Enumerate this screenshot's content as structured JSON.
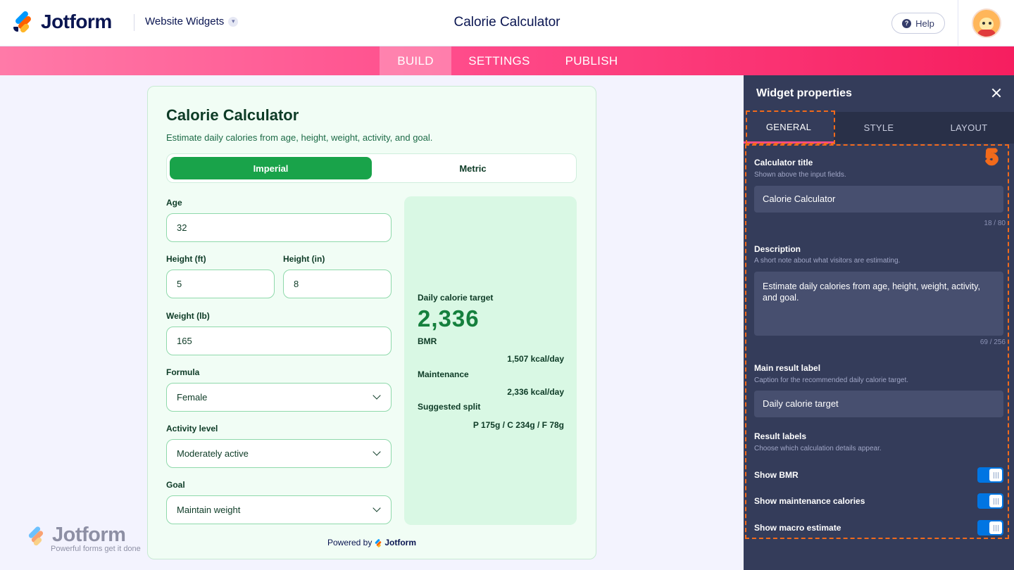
{
  "header": {
    "brand": "Jotform",
    "product_dropdown": "Website Widgets",
    "title": "Calorie Calculator",
    "help_label": "Help"
  },
  "nav": {
    "tabs": [
      {
        "label": "BUILD",
        "active": true
      },
      {
        "label": "SETTINGS",
        "active": false
      },
      {
        "label": "PUBLISH",
        "active": false
      }
    ]
  },
  "widget": {
    "title": "Calorie Calculator",
    "description": "Estimate daily calories from age, height, weight, activity, and goal.",
    "units": {
      "imperial": "Imperial",
      "metric": "Metric",
      "selected": "Imperial"
    },
    "fields": {
      "age": {
        "label": "Age",
        "value": "32"
      },
      "height_ft": {
        "label": "Height (ft)",
        "value": "5"
      },
      "height_in": {
        "label": "Height (in)",
        "value": "8"
      },
      "weight": {
        "label": "Weight (lb)",
        "value": "165"
      },
      "formula": {
        "label": "Formula",
        "value": "Female"
      },
      "activity": {
        "label": "Activity level",
        "value": "Moderately active"
      },
      "goal": {
        "label": "Goal",
        "value": "Maintain weight"
      }
    },
    "result": {
      "main_label": "Daily calorie target",
      "main_value": "2,336",
      "bmr_label": "BMR",
      "bmr_value": "1,507 kcal/day",
      "maintenance_label": "Maintenance",
      "maintenance_value": "2,336 kcal/day",
      "split_label": "Suggested split",
      "split_value": "P 175g / C 234g / F 78g"
    },
    "powered_by": "Powered by",
    "powered_brand": "Jotform"
  },
  "watermark": {
    "brand": "Jotform",
    "tagline": "Powerful forms get it done"
  },
  "panel": {
    "title": "Widget properties",
    "tabs": [
      {
        "label": "GENERAL",
        "active": true
      },
      {
        "label": "STYLE",
        "active": false
      },
      {
        "label": "LAYOUT",
        "active": false
      }
    ],
    "annotation_number": "5",
    "calc_title": {
      "label": "Calculator title",
      "hint": "Shown above the input fields.",
      "value": "Calorie Calculator",
      "count": "18 / 80"
    },
    "description": {
      "label": "Description",
      "hint": "A short note about what visitors are estimating.",
      "value": "Estimate daily calories from age, height, weight, activity, and goal.",
      "count": "69 / 256"
    },
    "main_result": {
      "label": "Main result label",
      "hint": "Caption for the recommended daily calorie target.",
      "value": "Daily calorie target"
    },
    "result_labels": {
      "label": "Result labels",
      "hint": "Choose which calculation details appear."
    },
    "toggles": [
      {
        "label": "Show BMR",
        "on": true
      },
      {
        "label": "Show maintenance calories",
        "on": true
      },
      {
        "label": "Show macro estimate",
        "on": true
      }
    ]
  },
  "colors": {
    "accent_pink": "#ff4c8b",
    "calculator_green": "#19a34a",
    "result_value_green": "#15803d",
    "panel_bg": "#343c5a",
    "highlight_orange": "#f26a1b",
    "toggle_blue": "#0075e3"
  }
}
